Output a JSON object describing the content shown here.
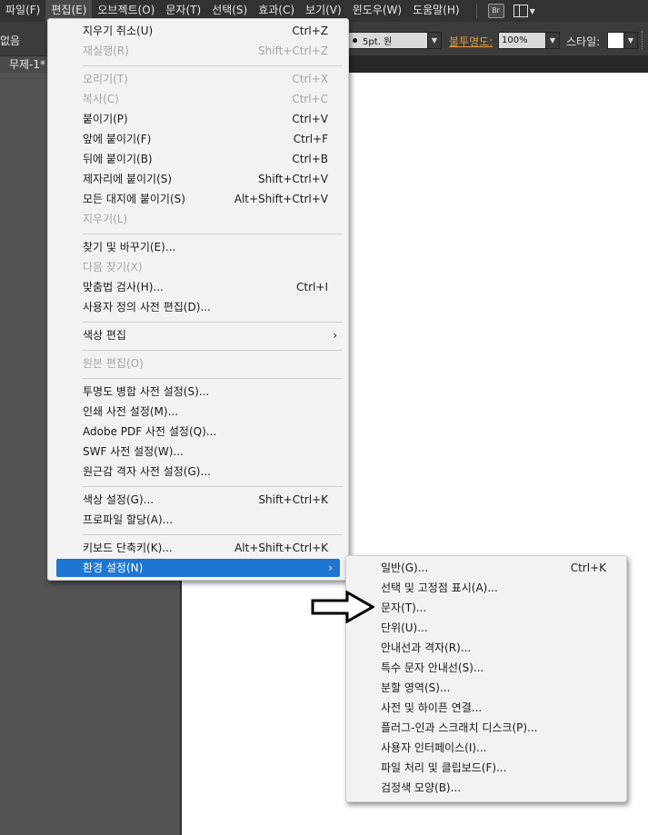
{
  "menubar": {
    "items": [
      "파일(F)",
      "편집(E)",
      "오브젝트(O)",
      "문자(T)",
      "선택(S)",
      "효과(C)",
      "보기(V)",
      "윈도우(W)",
      "도움말(H)"
    ],
    "bridge_badge": "Br"
  },
  "controlbar": {
    "selection_label": "없음",
    "stroke_value": "5pt. 원",
    "opacity_label": "불투명도:",
    "opacity_value": "100%",
    "style_label": "스타일:"
  },
  "document": {
    "tab_label": "무제-1*"
  },
  "edit_menu": {
    "items": [
      {
        "label": "지우기 취소(U)",
        "shortcut": "Ctrl+Z",
        "enabled": true
      },
      {
        "label": "재실행(R)",
        "shortcut": "Shift+Ctrl+Z",
        "enabled": false
      },
      {
        "label": "오리기(T)",
        "shortcut": "Ctrl+X",
        "enabled": false
      },
      {
        "label": "복사(C)",
        "shortcut": "Ctrl+C",
        "enabled": false
      },
      {
        "label": "붙이기(P)",
        "shortcut": "Ctrl+V",
        "enabled": true
      },
      {
        "label": "앞에 붙이기(F)",
        "shortcut": "Ctrl+F",
        "enabled": true
      },
      {
        "label": "뒤에 붙이기(B)",
        "shortcut": "Ctrl+B",
        "enabled": true
      },
      {
        "label": "제자리에 붙이기(S)",
        "shortcut": "Shift+Ctrl+V",
        "enabled": true
      },
      {
        "label": "모든 대지에 붙이기(S)",
        "shortcut": "Alt+Shift+Ctrl+V",
        "enabled": true
      },
      {
        "label": "지우기(L)",
        "shortcut": "",
        "enabled": false
      },
      {
        "label": "찾기 및 바꾸기(E)...",
        "shortcut": "",
        "enabled": true
      },
      {
        "label": "다음 찾기(X)",
        "shortcut": "",
        "enabled": false
      },
      {
        "label": "맞춤법 검사(H)...",
        "shortcut": "Ctrl+I",
        "enabled": true
      },
      {
        "label": "사용자 정의 사전 편집(D)...",
        "shortcut": "",
        "enabled": true
      },
      {
        "label": "색상 편집",
        "shortcut": "",
        "enabled": true,
        "submenu": true
      },
      {
        "label": "원본 편집(O)",
        "shortcut": "",
        "enabled": false
      },
      {
        "label": "투명도 병합 사전 설정(S)...",
        "shortcut": "",
        "enabled": true
      },
      {
        "label": "인쇄 사전 설정(M)...",
        "shortcut": "",
        "enabled": true
      },
      {
        "label": "Adobe PDF 사전 설정(Q)...",
        "shortcut": "",
        "enabled": true
      },
      {
        "label": "SWF 사전 설정(W)...",
        "shortcut": "",
        "enabled": true
      },
      {
        "label": "원근감 격자 사전 설정(G)...",
        "shortcut": "",
        "enabled": true
      },
      {
        "label": "색상 설정(G)...",
        "shortcut": "Shift+Ctrl+K",
        "enabled": true
      },
      {
        "label": "프로파일 할당(A)...",
        "shortcut": "",
        "enabled": true
      },
      {
        "label": "키보드 단축키(K)...",
        "shortcut": "Alt+Shift+Ctrl+K",
        "enabled": true
      },
      {
        "label": "환경 설정(N)",
        "shortcut": "",
        "enabled": true,
        "submenu": true,
        "highlighted": true
      }
    ]
  },
  "preferences_submenu": {
    "items": [
      {
        "label": "일반(G)...",
        "shortcut": "Ctrl+K"
      },
      {
        "label": "선택 및 고정점 표시(A)...",
        "shortcut": ""
      },
      {
        "label": "문자(T)...",
        "shortcut": ""
      },
      {
        "label": "단위(U)...",
        "shortcut": ""
      },
      {
        "label": "안내선과 격자(R)...",
        "shortcut": ""
      },
      {
        "label": "특수 문자 안내선(S)...",
        "shortcut": ""
      },
      {
        "label": "분할 영역(S)...",
        "shortcut": ""
      },
      {
        "label": "사전 및 하이픈 연결...",
        "shortcut": ""
      },
      {
        "label": "플러그-인과 스크래치 디스크(P)...",
        "shortcut": ""
      },
      {
        "label": "사용자 인터페이스(I)...",
        "shortcut": ""
      },
      {
        "label": "파일 처리 및 클립보드(F)...",
        "shortcut": ""
      },
      {
        "label": "검정색 모양(B)...",
        "shortcut": ""
      }
    ]
  },
  "colors": {
    "highlight": "#1f76d2",
    "opacity_label": "#e39a3a",
    "menubar_bg": "#323232",
    "workspace_bg": "#535353"
  },
  "icons": {
    "submenu_arrow": "›",
    "dropdown_caret": "▼",
    "annotation": "arrow-right-outline-icon"
  }
}
